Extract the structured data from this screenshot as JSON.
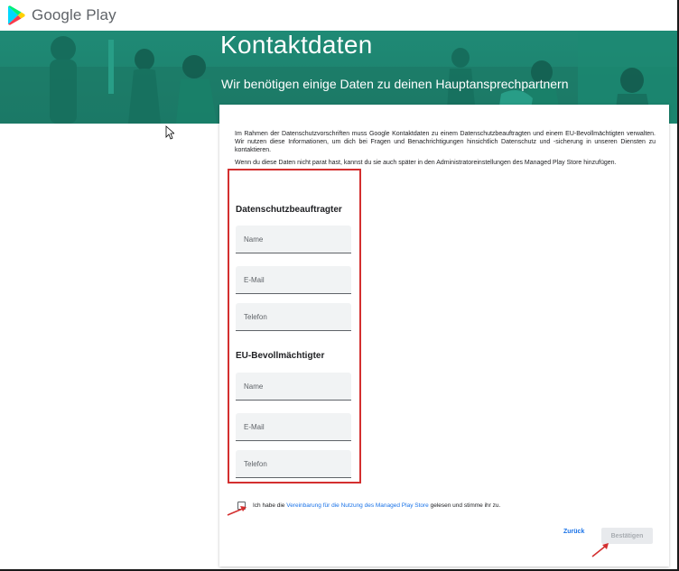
{
  "header": {
    "brand": "Google Play"
  },
  "hero": {
    "title": "Kontaktdaten",
    "subtitle": "Wir benötigen einige Daten zu deinen Hauptansprechpartnern"
  },
  "intro": {
    "paragraph1": "Im Rahmen der Datenschutzvorschriften muss Google Kontaktdaten zu einem Datenschutzbeauftragten und einem EU-Bevollmächtigten verwalten. Wir nutzen diese Informationen, um dich bei Fragen und Benachrichtigungen hinsichtlich Datenschutz und -sicherung in unseren Diensten zu kontaktieren.",
    "paragraph2": "Wenn du diese Daten nicht parat hast, kannst du sie auch später in den Administratoreinstellungen des Managed Play Store hinzufügen."
  },
  "dpo": {
    "title": "Datenschutzbeauftragter",
    "name_placeholder": "Name",
    "email_placeholder": "E-Mail",
    "phone_placeholder": "Telefon"
  },
  "eu_rep": {
    "title": "EU-Bevollmächtigter",
    "name_placeholder": "Name",
    "email_placeholder": "E-Mail",
    "phone_placeholder": "Telefon"
  },
  "agreement": {
    "prefix": "Ich habe die ",
    "link": "Vereinbarung für die Nutzung des Managed Play Store",
    "suffix": " gelesen und stimme ihr zu.",
    "checked": false
  },
  "actions": {
    "back_label": "Zurück",
    "confirm_label": "Bestätigen"
  },
  "colors": {
    "hero_bg": "#1f8a75",
    "highlight": "#d32f2f",
    "link": "#1a73e8"
  }
}
